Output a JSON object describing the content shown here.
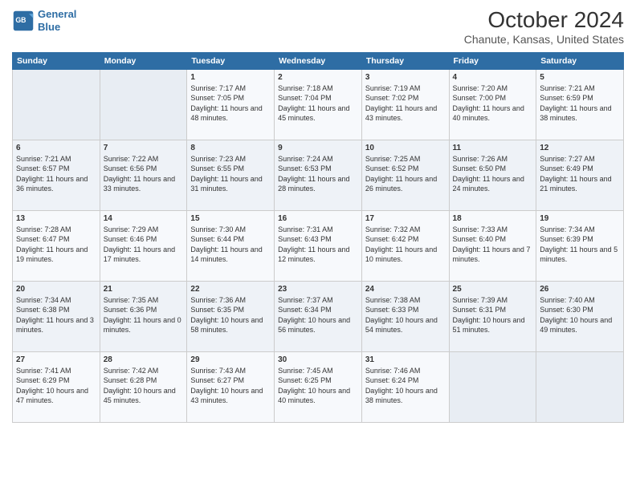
{
  "header": {
    "logo_line1": "General",
    "logo_line2": "Blue",
    "title": "October 2024",
    "subtitle": "Chanute, Kansas, United States"
  },
  "weekdays": [
    "Sunday",
    "Monday",
    "Tuesday",
    "Wednesday",
    "Thursday",
    "Friday",
    "Saturday"
  ],
  "weeks": [
    [
      {
        "day": "",
        "sunrise": "",
        "sunset": "",
        "daylight": ""
      },
      {
        "day": "",
        "sunrise": "",
        "sunset": "",
        "daylight": ""
      },
      {
        "day": "1",
        "sunrise": "Sunrise: 7:17 AM",
        "sunset": "Sunset: 7:05 PM",
        "daylight": "Daylight: 11 hours and 48 minutes."
      },
      {
        "day": "2",
        "sunrise": "Sunrise: 7:18 AM",
        "sunset": "Sunset: 7:04 PM",
        "daylight": "Daylight: 11 hours and 45 minutes."
      },
      {
        "day": "3",
        "sunrise": "Sunrise: 7:19 AM",
        "sunset": "Sunset: 7:02 PM",
        "daylight": "Daylight: 11 hours and 43 minutes."
      },
      {
        "day": "4",
        "sunrise": "Sunrise: 7:20 AM",
        "sunset": "Sunset: 7:00 PM",
        "daylight": "Daylight: 11 hours and 40 minutes."
      },
      {
        "day": "5",
        "sunrise": "Sunrise: 7:21 AM",
        "sunset": "Sunset: 6:59 PM",
        "daylight": "Daylight: 11 hours and 38 minutes."
      }
    ],
    [
      {
        "day": "6",
        "sunrise": "Sunrise: 7:21 AM",
        "sunset": "Sunset: 6:57 PM",
        "daylight": "Daylight: 11 hours and 36 minutes."
      },
      {
        "day": "7",
        "sunrise": "Sunrise: 7:22 AM",
        "sunset": "Sunset: 6:56 PM",
        "daylight": "Daylight: 11 hours and 33 minutes."
      },
      {
        "day": "8",
        "sunrise": "Sunrise: 7:23 AM",
        "sunset": "Sunset: 6:55 PM",
        "daylight": "Daylight: 11 hours and 31 minutes."
      },
      {
        "day": "9",
        "sunrise": "Sunrise: 7:24 AM",
        "sunset": "Sunset: 6:53 PM",
        "daylight": "Daylight: 11 hours and 28 minutes."
      },
      {
        "day": "10",
        "sunrise": "Sunrise: 7:25 AM",
        "sunset": "Sunset: 6:52 PM",
        "daylight": "Daylight: 11 hours and 26 minutes."
      },
      {
        "day": "11",
        "sunrise": "Sunrise: 7:26 AM",
        "sunset": "Sunset: 6:50 PM",
        "daylight": "Daylight: 11 hours and 24 minutes."
      },
      {
        "day": "12",
        "sunrise": "Sunrise: 7:27 AM",
        "sunset": "Sunset: 6:49 PM",
        "daylight": "Daylight: 11 hours and 21 minutes."
      }
    ],
    [
      {
        "day": "13",
        "sunrise": "Sunrise: 7:28 AM",
        "sunset": "Sunset: 6:47 PM",
        "daylight": "Daylight: 11 hours and 19 minutes."
      },
      {
        "day": "14",
        "sunrise": "Sunrise: 7:29 AM",
        "sunset": "Sunset: 6:46 PM",
        "daylight": "Daylight: 11 hours and 17 minutes."
      },
      {
        "day": "15",
        "sunrise": "Sunrise: 7:30 AM",
        "sunset": "Sunset: 6:44 PM",
        "daylight": "Daylight: 11 hours and 14 minutes."
      },
      {
        "day": "16",
        "sunrise": "Sunrise: 7:31 AM",
        "sunset": "Sunset: 6:43 PM",
        "daylight": "Daylight: 11 hours and 12 minutes."
      },
      {
        "day": "17",
        "sunrise": "Sunrise: 7:32 AM",
        "sunset": "Sunset: 6:42 PM",
        "daylight": "Daylight: 11 hours and 10 minutes."
      },
      {
        "day": "18",
        "sunrise": "Sunrise: 7:33 AM",
        "sunset": "Sunset: 6:40 PM",
        "daylight": "Daylight: 11 hours and 7 minutes."
      },
      {
        "day": "19",
        "sunrise": "Sunrise: 7:34 AM",
        "sunset": "Sunset: 6:39 PM",
        "daylight": "Daylight: 11 hours and 5 minutes."
      }
    ],
    [
      {
        "day": "20",
        "sunrise": "Sunrise: 7:34 AM",
        "sunset": "Sunset: 6:38 PM",
        "daylight": "Daylight: 11 hours and 3 minutes."
      },
      {
        "day": "21",
        "sunrise": "Sunrise: 7:35 AM",
        "sunset": "Sunset: 6:36 PM",
        "daylight": "Daylight: 11 hours and 0 minutes."
      },
      {
        "day": "22",
        "sunrise": "Sunrise: 7:36 AM",
        "sunset": "Sunset: 6:35 PM",
        "daylight": "Daylight: 10 hours and 58 minutes."
      },
      {
        "day": "23",
        "sunrise": "Sunrise: 7:37 AM",
        "sunset": "Sunset: 6:34 PM",
        "daylight": "Daylight: 10 hours and 56 minutes."
      },
      {
        "day": "24",
        "sunrise": "Sunrise: 7:38 AM",
        "sunset": "Sunset: 6:33 PM",
        "daylight": "Daylight: 10 hours and 54 minutes."
      },
      {
        "day": "25",
        "sunrise": "Sunrise: 7:39 AM",
        "sunset": "Sunset: 6:31 PM",
        "daylight": "Daylight: 10 hours and 51 minutes."
      },
      {
        "day": "26",
        "sunrise": "Sunrise: 7:40 AM",
        "sunset": "Sunset: 6:30 PM",
        "daylight": "Daylight: 10 hours and 49 minutes."
      }
    ],
    [
      {
        "day": "27",
        "sunrise": "Sunrise: 7:41 AM",
        "sunset": "Sunset: 6:29 PM",
        "daylight": "Daylight: 10 hours and 47 minutes."
      },
      {
        "day": "28",
        "sunrise": "Sunrise: 7:42 AM",
        "sunset": "Sunset: 6:28 PM",
        "daylight": "Daylight: 10 hours and 45 minutes."
      },
      {
        "day": "29",
        "sunrise": "Sunrise: 7:43 AM",
        "sunset": "Sunset: 6:27 PM",
        "daylight": "Daylight: 10 hours and 43 minutes."
      },
      {
        "day": "30",
        "sunrise": "Sunrise: 7:45 AM",
        "sunset": "Sunset: 6:25 PM",
        "daylight": "Daylight: 10 hours and 40 minutes."
      },
      {
        "day": "31",
        "sunrise": "Sunrise: 7:46 AM",
        "sunset": "Sunset: 6:24 PM",
        "daylight": "Daylight: 10 hours and 38 minutes."
      },
      {
        "day": "",
        "sunrise": "",
        "sunset": "",
        "daylight": ""
      },
      {
        "day": "",
        "sunrise": "",
        "sunset": "",
        "daylight": ""
      }
    ]
  ]
}
